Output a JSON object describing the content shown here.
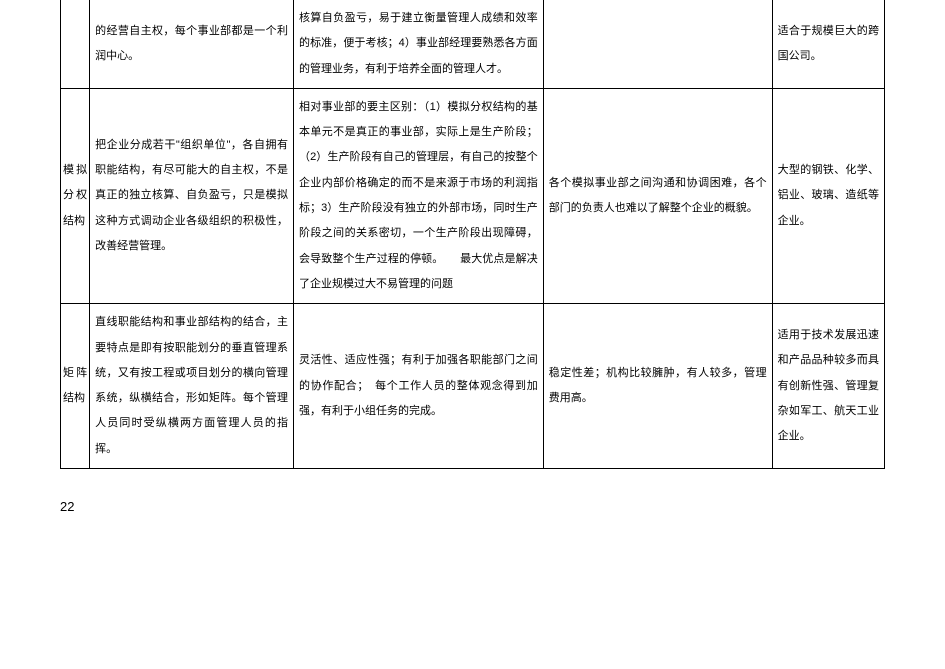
{
  "table": {
    "rows": [
      {
        "c0": "",
        "c1": "的经营自主权，每个事业部都是一个利润中心。",
        "c2": "核算自负盈亏，易于建立衡量管理人成绩和效率的标准，便于考核；4）事业部经理要熟悉各方面的管理业务，有利于培养全面的管理人才。",
        "c3": "",
        "c4": "适合于规模巨大的跨国公司。"
      },
      {
        "c0": "模拟分权结构",
        "c1": "把企业分成若干\"组织单位\"，各自拥有职能结构，有尽可能大的自主权，不是真正的独立核算、自负盈亏，只是模拟这种方式调动企业各级组织的积极性，改善经营管理。",
        "c2": "相对事业部的要主区别：（1）模拟分权结构的基本单元不是真正的事业部，实际上是生产阶段；（2）生产阶段有自己的管理层，有自己的按整个企业内部价格确定的而不是来源于市场的利润指标；3）生产阶段没有独立的外部市场，同时生产阶段之间的关系密切，一个生产阶段出现障碍，会导致整个生产过程的停顿。　　最大优点是解决了企业规模过大不易管理的问题",
        "c3": "各个模拟事业部之间沟通和协调困难，各个部门的负责人也难以了解整个企业的概貌。",
        "c4": "大型的钢铁、化学、铝业、玻璃、造纸等企业。"
      },
      {
        "c0": "矩阵结构",
        "c1": "直线职能结构和事业部结构的结合，主要特点是即有按职能划分的垂直管理系统，又有按工程或项目划分的横向管理系统，纵横结合，形如矩阵。每个管理人员同时受纵横两方面管理人员的指挥。",
        "c2": "灵活性、适应性强；有利于加强各职能部门之间的协作配合；　每个工作人员的整体观念得到加强，有利于小组任务的完成。",
        "c3": "稳定性差；机构比较臃肿，有人较多，管理费用高。",
        "c4": "适用于技术发展迅速和产品品种较多而具有创新性强、管理复杂如军工、航天工业企业。"
      }
    ]
  },
  "page_number": "22"
}
